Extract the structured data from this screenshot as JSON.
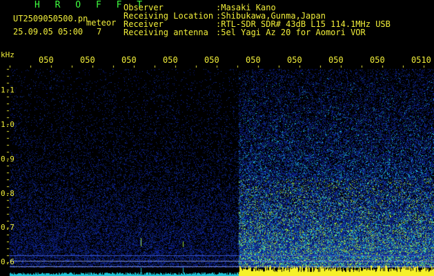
{
  "header": {
    "brand": "H R O F F T",
    "filename": "UT2509050500.pn",
    "event_label": "meteor",
    "datetime": "25.09.05 05:00",
    "count": "7",
    "observer_label": "Observer",
    "observer_value": ":Masaki Kano",
    "location_label": "Receiving Location",
    "location_value": ":Shibukawa,Gunma,Japan",
    "receiver_label": "Receiver",
    "receiver_value": ":RTL-SDR SDR# 43dB L15 114.1MHz USB",
    "antenna_label": "Receiving antenna",
    "antenna_value": ":5el Yagi Az 20 for Aomori VOR"
  },
  "axis": {
    "unit": "kHz",
    "time_ticks": [
      "050",
      "050",
      "050",
      "050",
      "050",
      "050",
      "050",
      "050",
      "050",
      "0510"
    ],
    "freq_ticks": [
      "1.1",
      "1.0",
      "0.9",
      "0.8",
      "0.7",
      "0.6"
    ]
  },
  "colors": {
    "header_green": "#3fff3f",
    "header_yellow": "#f2ef3a",
    "spectrogram_low": "#0a1a8c",
    "spectrogram_mid": "#1fc3d6",
    "spectrogram_high": "#f6f12a"
  }
}
